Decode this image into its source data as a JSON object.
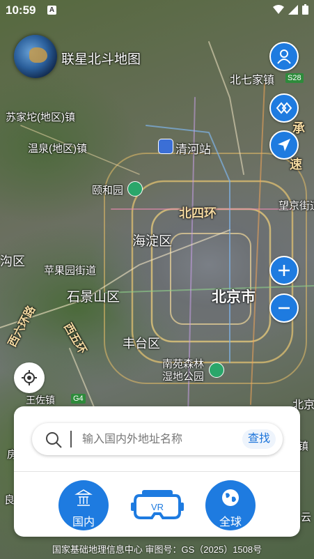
{
  "status_bar": {
    "time": "10:59",
    "notification_icon": "A"
  },
  "app": {
    "title": "联星北斗地图"
  },
  "map": {
    "labels": {
      "beiqijiazhen": "北七家镇",
      "s28": "S28",
      "sujiatuo": "苏家坨(地区)镇",
      "wenquan": "温泉(地区)镇",
      "qinghezhan": "清河站",
      "yiheyuan": "颐和园",
      "beisihuan": "北四环",
      "wangjing": "望京街道",
      "haidian": "海淀区",
      "gou": "沟区",
      "pingguoyuan": "苹果园街道",
      "shijingshan": "石景山区",
      "beijingshi": "北京市",
      "xiliuhuan": "西六环路",
      "xiwuhuan": "西五环",
      "fengtai": "丰台区",
      "nanyuan": "南苑森林湿地公园",
      "wangzuo": "王佐镇",
      "g4": "G4",
      "beijing_right": "北京",
      "cheng": "承",
      "su": "速",
      "zhen": "镇",
      "yun": "云",
      "liang": "良",
      "fang": "房"
    }
  },
  "search": {
    "placeholder": "输入国内外地址名称",
    "button": "查找"
  },
  "modes": {
    "domestic": "国内",
    "vr": "VR",
    "global": "全球"
  },
  "footer": {
    "text": "国家基础地理信息中心 审图号：GS（2025）1508号"
  },
  "colors": {
    "accent": "#1e7be0",
    "panel_bg": "#ffffff",
    "search_btn_text": "#1a73d9"
  },
  "icons": [
    "user-icon",
    "layers-icon",
    "navigation-arrow-icon",
    "zoom-in-icon",
    "zoom-out-icon",
    "locate-icon",
    "search-icon",
    "temple-icon",
    "vr-headset-icon",
    "globe-icon"
  ]
}
